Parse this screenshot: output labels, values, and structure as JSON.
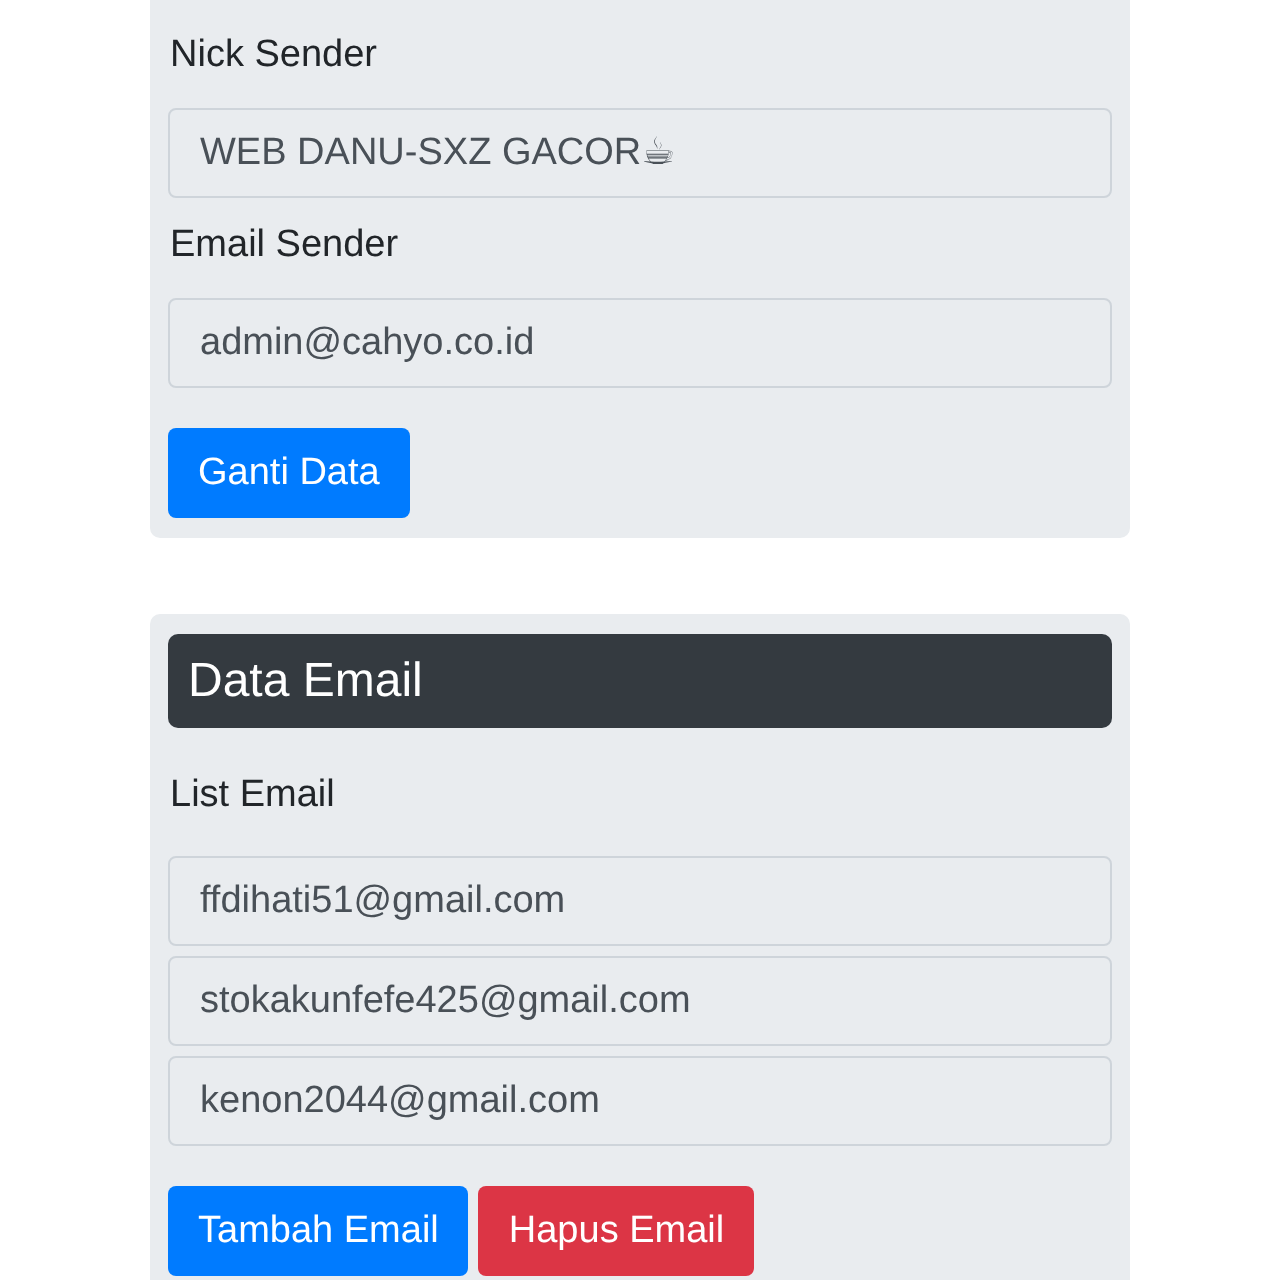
{
  "sender_card": {
    "fields": [
      {
        "label": "Nick Sender",
        "value": "WEB DANU-SXZ GACOR☕"
      },
      {
        "label": "Email Sender",
        "value": "admin@cahyo.co.id"
      }
    ],
    "buttons": [
      {
        "label": "Ganti Data",
        "kind": "primary"
      }
    ]
  },
  "email_card": {
    "title": "Data Email",
    "list_label": "List Email",
    "emails": [
      "ffdihati51@gmail.com",
      "stokakunfefe425@gmail.com",
      "kenon2044@gmail.com"
    ],
    "buttons": [
      {
        "label": "Tambah Email",
        "kind": "primary"
      },
      {
        "label": "Hapus Email",
        "kind": "danger"
      }
    ]
  }
}
